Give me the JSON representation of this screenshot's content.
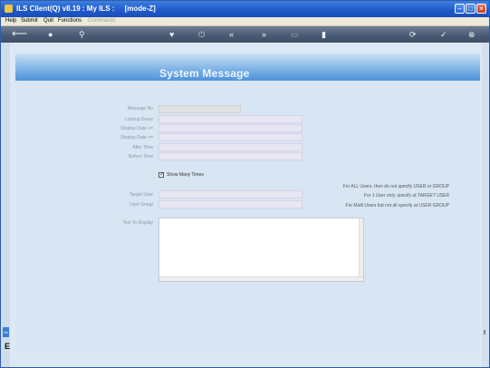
{
  "window": {
    "title": "ILS Client(Q) v8.19 : My ILS :     [mode-Z]"
  },
  "menu": {
    "items": [
      {
        "label": "Help",
        "enabled": true
      },
      {
        "label": "Submit",
        "enabled": true
      },
      {
        "label": "Quit",
        "enabled": true
      },
      {
        "label": "Functions",
        "enabled": true
      },
      {
        "label": "Commands",
        "enabled": false
      }
    ]
  },
  "toolbar": {
    "icons": [
      "back-arrow-icon",
      "info-icon",
      "search-icon",
      "heart-icon",
      "power-icon",
      "rewind-icon",
      "fast-forward-icon",
      "document-icon",
      "clipboard-icon",
      "sync-icon",
      "confirm-icon",
      "cancel-icon"
    ]
  },
  "page": {
    "title": "System Message"
  },
  "form": {
    "labels": {
      "message_no": "Message No",
      "lookup_descr": "Lookup Descr",
      "display_date_from": "Display Date >=",
      "display_date_to": "Display Date <=",
      "after_time": "After Time",
      "before_time": "Before Time",
      "target_user": "Target User",
      "user_group": "User Group",
      "text_to_display": "Text To Display"
    },
    "values": {
      "message_no": "",
      "lookup_descr": "",
      "display_date_from": "",
      "display_date_to": "",
      "after_time": "",
      "before_time": "",
      "target_user": "",
      "user_group": "",
      "text_to_display": ""
    },
    "show_many_times": {
      "label": "Show Many Times",
      "checked": true
    }
  },
  "hints": {
    "all_users": "For ALL Users, then do not specify USER or GROUP",
    "one_user": "For 1 User only, specify at TARGET USER",
    "multi_users": "For Multi Users but not all specify at USER GROUP"
  },
  "side": {
    "tab_label": "Go",
    "marker": "E"
  },
  "colors": {
    "titlebar": "#1f58c9",
    "banner": "#4f92d9",
    "background": "#dce8f3"
  }
}
